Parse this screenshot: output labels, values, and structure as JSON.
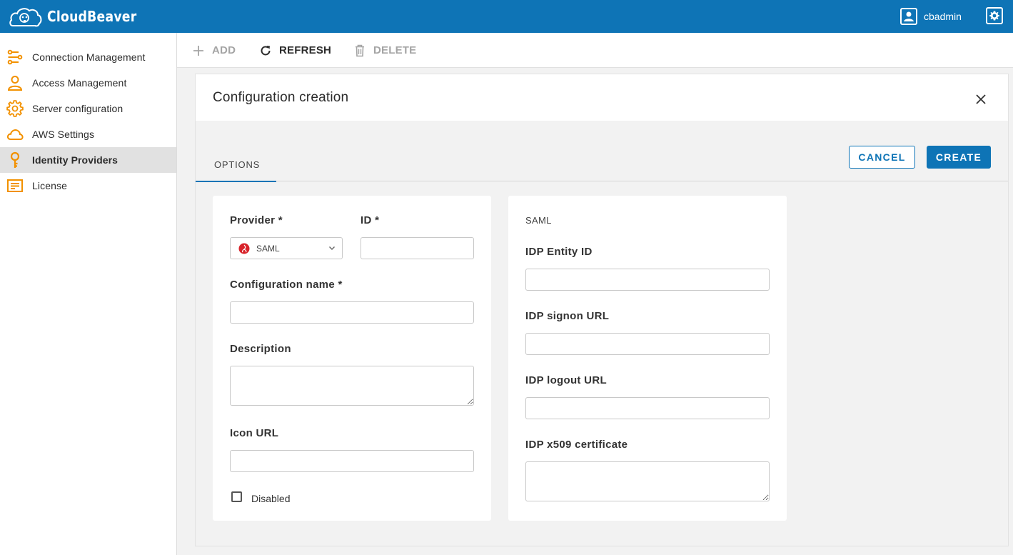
{
  "app": {
    "logo_text": "CloudBeaver",
    "user_name": "cbadmin",
    "brand_color": "#0e74b6",
    "accent_color": "#f29100"
  },
  "sidebar": {
    "items": [
      {
        "label": "Connection Management",
        "icon": "connection-icon",
        "active": false
      },
      {
        "label": "Access Management",
        "icon": "user-icon",
        "active": false
      },
      {
        "label": "Server configuration",
        "icon": "gear-icon",
        "active": false
      },
      {
        "label": "AWS Settings",
        "icon": "cloud-icon",
        "active": false
      },
      {
        "label": "Identity Providers",
        "icon": "key-icon",
        "active": true
      },
      {
        "label": "License",
        "icon": "license-icon",
        "active": false
      }
    ]
  },
  "toolbar": {
    "add_label": "ADD",
    "refresh_label": "REFRESH",
    "delete_label": "DELETE"
  },
  "dialog": {
    "title": "Configuration creation",
    "tab_options": "OPTIONS",
    "cancel_label": "CANCEL",
    "create_label": "CREATE"
  },
  "form": {
    "provider_label": "Provider *",
    "provider_value": "SAML",
    "id_label": "ID *",
    "id_value": "",
    "config_name_label": "Configuration name *",
    "config_name_value": "",
    "description_label": "Description",
    "description_value": "",
    "icon_url_label": "Icon URL",
    "icon_url_value": "",
    "disabled_label": "Disabled",
    "disabled_checked": false
  },
  "saml": {
    "section_title": "SAML",
    "entity_id_label": "IDP Entity ID",
    "signon_url_label": "IDP signon URL",
    "logout_url_label": "IDP logout URL",
    "certificate_label": "IDP x509 certificate"
  }
}
